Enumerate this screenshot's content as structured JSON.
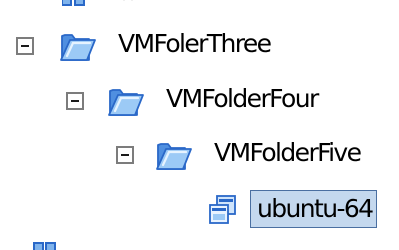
{
  "tree": {
    "nodes": [
      {
        "label": "VMFolerThree",
        "type": "folder",
        "expanded": true
      },
      {
        "label": "VMFolderFour",
        "type": "folder",
        "expanded": true
      },
      {
        "label": "VMFolderFive",
        "type": "folder",
        "expanded": true
      },
      {
        "label": "ubuntu-64",
        "type": "virtual-machine",
        "selected": true
      }
    ]
  },
  "colors": {
    "folder_fill": "#7fb3ec",
    "folder_outline": "#2a68c8",
    "folder_highlight": "#d8ecff",
    "selection_background": "#c4d8ee",
    "selection_border": "#4a6fa1",
    "expander_border": "#7c7c7c"
  }
}
